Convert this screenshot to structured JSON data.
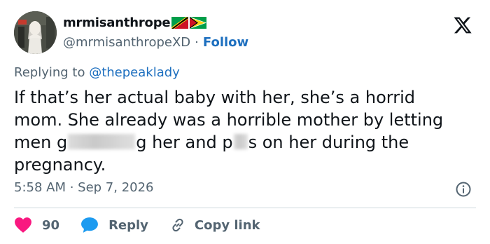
{
  "user": {
    "display_name": "mrmisanthrope",
    "handle": "@mrmisanthropeXD",
    "separator": "·",
    "follow_label": "Follow",
    "flags": [
      "saint-kitts-and-nevis-flag-icon",
      "guyana-flag-icon"
    ]
  },
  "reply_context": {
    "prefix": "Replying to",
    "mention": "@thepeaklady"
  },
  "tweet": {
    "line1": "If that’s her actual baby with her, she’s a horrid",
    "line2": "mom. She already was a horrible mother by letting",
    "line3_a": "men g",
    "line3_b": "g her and p",
    "line3_c": "s on her during the",
    "line4": "pregnancy."
  },
  "meta": {
    "timestamp": "5:58 AM · Sep 7, 2026",
    "info_icon": "info-icon"
  },
  "actions": {
    "like_count": "90",
    "reply_label": "Reply",
    "copy_link_label": "Copy link"
  },
  "colors": {
    "text": "#0f1419",
    "secondary": "#536471",
    "link": "#1d6fbf",
    "like": "#f91880",
    "reply": "#1d9bf0",
    "divider": "#cfd9de"
  }
}
